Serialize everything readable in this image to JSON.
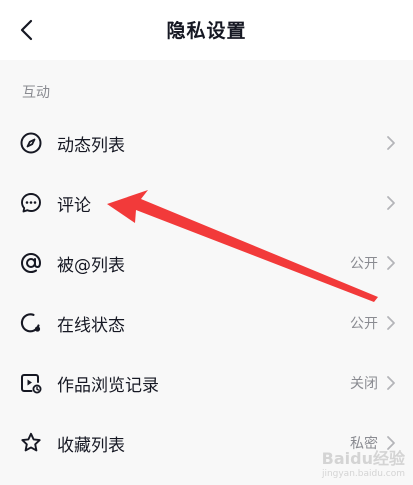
{
  "header": {
    "title": "隐私设置",
    "back_icon": "chevron-left-icon"
  },
  "section": {
    "label": "互动"
  },
  "rows": [
    {
      "label": "动态列表",
      "value": "",
      "icon": "compass-icon"
    },
    {
      "label": "评论",
      "value": "",
      "icon": "comment-icon"
    },
    {
      "label": "被@列表",
      "value": "公开",
      "icon": "at-icon"
    },
    {
      "label": "在线状态",
      "value": "公开",
      "icon": "online-status-icon"
    },
    {
      "label": "作品浏览记录",
      "value": "关闭",
      "icon": "view-history-icon"
    },
    {
      "label": "收藏列表",
      "value": "私密",
      "icon": "star-icon"
    }
  ],
  "annotation": {
    "color": "#f23a3a"
  },
  "watermark": {
    "main": "Baidu经验",
    "sub": "jingyan.baidu.com"
  }
}
